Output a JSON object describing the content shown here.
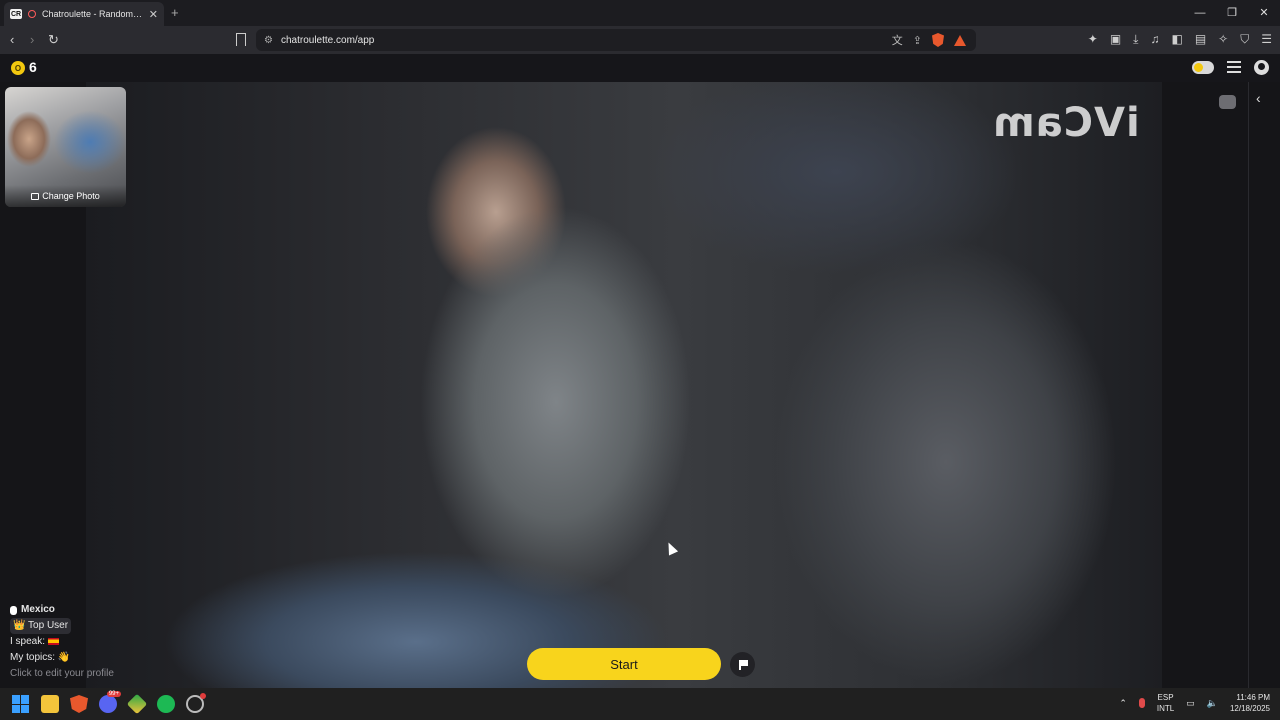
{
  "browser": {
    "tab_title": "Chatroulette - Random video chat",
    "tab_favicon_text": "CR",
    "new_tab_symbol": "+",
    "url": "chatroulette.com/app",
    "window_controls": [
      "—",
      "❐",
      "✕"
    ]
  },
  "site": {
    "coin_symbol": "O",
    "coin_count": "6",
    "colors": {
      "accent": "#f8d41c",
      "background": "#111114"
    }
  },
  "video": {
    "watermark": "iVCam"
  },
  "self_preview": {
    "change_photo_label": "Change Photo"
  },
  "partner_info": {
    "country": "Mexico",
    "badge": "👑 Top User",
    "speak_label": "I speak:",
    "topics_label": "My topics:",
    "topics_emoji": "👋",
    "edit_hint": "Click to edit your profile"
  },
  "controls": {
    "start_label": "Start"
  },
  "taskbar": {
    "discord_badge": "99+",
    "lang_line1": "ESP",
    "lang_line2": "INTL",
    "time": "11:46 PM",
    "date": "12/18/2025"
  }
}
